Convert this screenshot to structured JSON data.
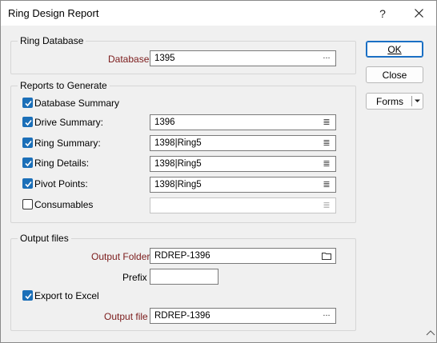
{
  "window": {
    "title": "Ring Design Report",
    "help_glyph": "?",
    "close_icon": "close-icon"
  },
  "ring_database": {
    "legend": "Ring Database",
    "database_label": "Database",
    "database_value": "1395",
    "database_browse": "..."
  },
  "reports": {
    "legend": "Reports to Generate",
    "items": [
      {
        "label": "Database Summary",
        "checked": true
      },
      {
        "label": "Drive Summary:",
        "checked": true,
        "value": "1396"
      },
      {
        "label": "Ring Summary:",
        "checked": true,
        "value": "1398|Ring5"
      },
      {
        "label": "Ring Details:",
        "checked": true,
        "value": "1398|Ring5"
      },
      {
        "label": "Pivot Points:",
        "checked": true,
        "value": "1398|Ring5"
      },
      {
        "label": "Consumables",
        "checked": false,
        "value": ""
      }
    ],
    "list_icon": "list-icon"
  },
  "output": {
    "legend": "Output files",
    "folder_label": "Output Folder",
    "folder_value": "RDREP-1396",
    "folder_icon": "folder-icon",
    "prefix_label": "Prefix",
    "prefix_value": "",
    "export_label": "Export to Excel",
    "export_checked": true,
    "file_label": "Output file",
    "file_value": "RDREP-1396",
    "file_browse": "..."
  },
  "buttons": {
    "ok": "OK",
    "close": "Close",
    "forms": "Forms"
  },
  "colors": {
    "accent": "#1b6fb8",
    "required_label": "#7b1b1b"
  }
}
